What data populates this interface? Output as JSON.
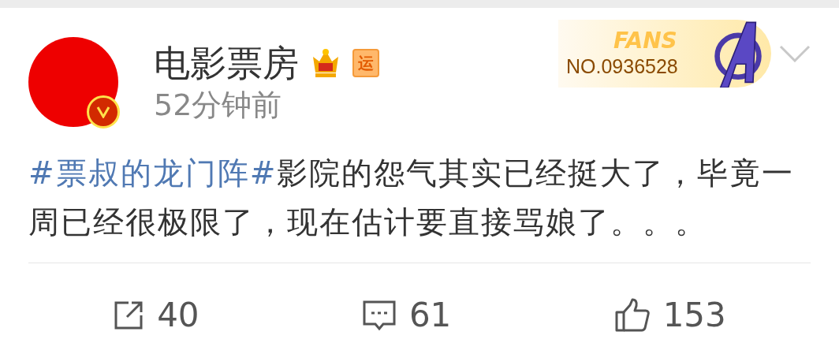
{
  "author": {
    "name": "电影票房",
    "badges": [
      {
        "kind": "crown"
      },
      {
        "kind": "tag",
        "text": "运"
      }
    ],
    "time": "52分钟前",
    "verified": true
  },
  "fans_badge": {
    "label": "FANS",
    "number": "NO.0936528"
  },
  "post": {
    "segments": [
      {
        "kind": "hashtag",
        "text": "#票叔的龙门阵#"
      },
      {
        "kind": "text",
        "text": "影院的怨气其实已经挺大了，毕竟一周已经很极限了，现在估计要直接骂娘了。。。"
      }
    ]
  },
  "actions": [
    {
      "kind": "share",
      "count": "40"
    },
    {
      "kind": "comment",
      "count": "61"
    },
    {
      "kind": "like",
      "count": "153"
    }
  ]
}
